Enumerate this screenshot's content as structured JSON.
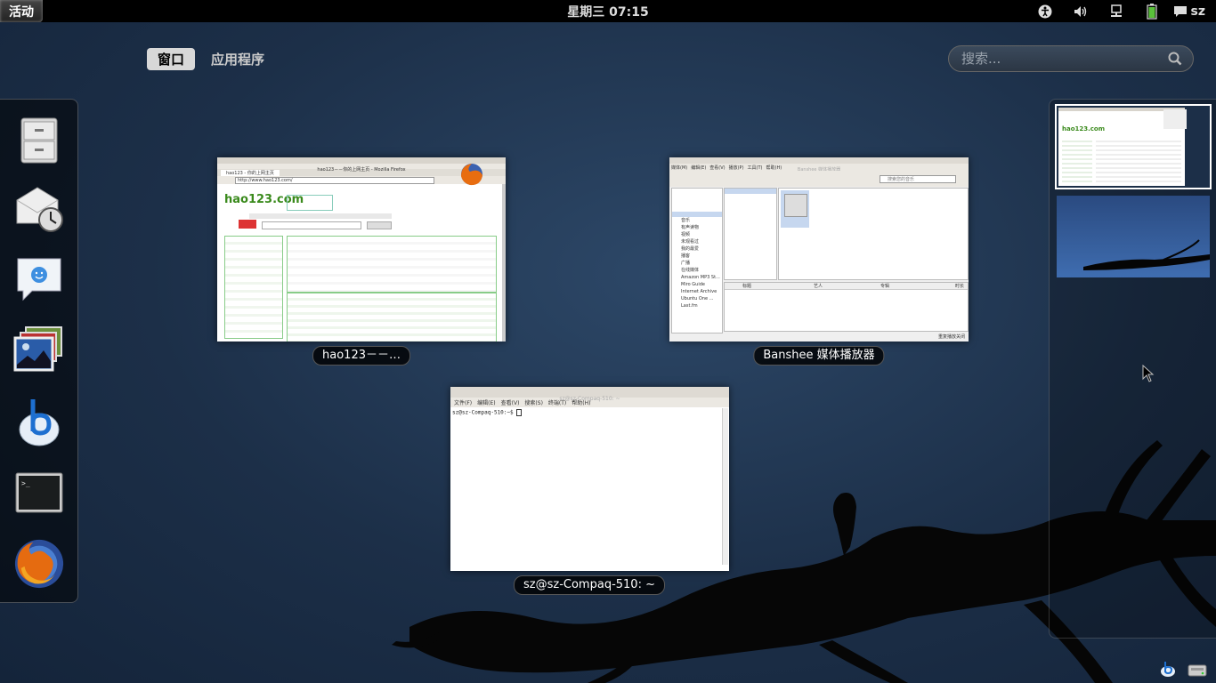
{
  "topbar": {
    "activities": "活动",
    "clock": "星期三 07:15",
    "user": "sz"
  },
  "overview": {
    "tabs": [
      {
        "label": "窗口",
        "active": true
      },
      {
        "label": "应用程序",
        "active": false
      }
    ],
    "search_placeholder": "搜索..."
  },
  "dash": {
    "items": [
      {
        "name": "file-cabinet-icon"
      },
      {
        "name": "mail-clock-icon"
      },
      {
        "name": "chat-bubble-icon"
      },
      {
        "name": "photos-icon"
      },
      {
        "name": "banshee-icon"
      },
      {
        "name": "terminal-icon"
      },
      {
        "name": "firefox-icon"
      }
    ]
  },
  "windows": {
    "firefox": {
      "caption": "hao123－－…",
      "title": "hao123－－你的上网主页 - Mozilla Firefox",
      "url": "http://www.hao123.com/",
      "tab": "hao123 - 你的上网主页",
      "logo": "hao123.com"
    },
    "banshee": {
      "caption": "Banshee 媒体播放器",
      "title": "Banshee 媒体播放器",
      "menu": [
        "媒体(M)",
        "编辑(E)",
        "查看(V)",
        "播放(P)",
        "工具(T)",
        "帮助(H)"
      ],
      "sidebar": [
        "音乐",
        "有声读物",
        "视频",
        "未观看过",
        "我的最爱",
        "播客",
        "广播",
        "在线媒体",
        "Amazon MP3 St...",
        "Miro Guide",
        "Internet Archive",
        "Ubuntu One ...",
        "Last.fm"
      ],
      "columns": [
        "标题",
        "艺人",
        "专辑",
        "时长"
      ],
      "search_placeholder": "搜索您的音乐",
      "status": "重复播放关闭"
    },
    "terminal": {
      "caption": "sz@sz-Compaq-510: ~",
      "title": "sz@sz-Compaq-510: ~",
      "menu": [
        "文件(F)",
        "编辑(E)",
        "查看(V)",
        "搜索(S)",
        "终端(T)",
        "帮助(H)"
      ],
      "prompt": "sz@sz-Compaq-510:~$ "
    }
  },
  "colors": {
    "background": "#1c2f48",
    "accent": "#ffffff",
    "banshee_select": "#c6d7ef"
  }
}
